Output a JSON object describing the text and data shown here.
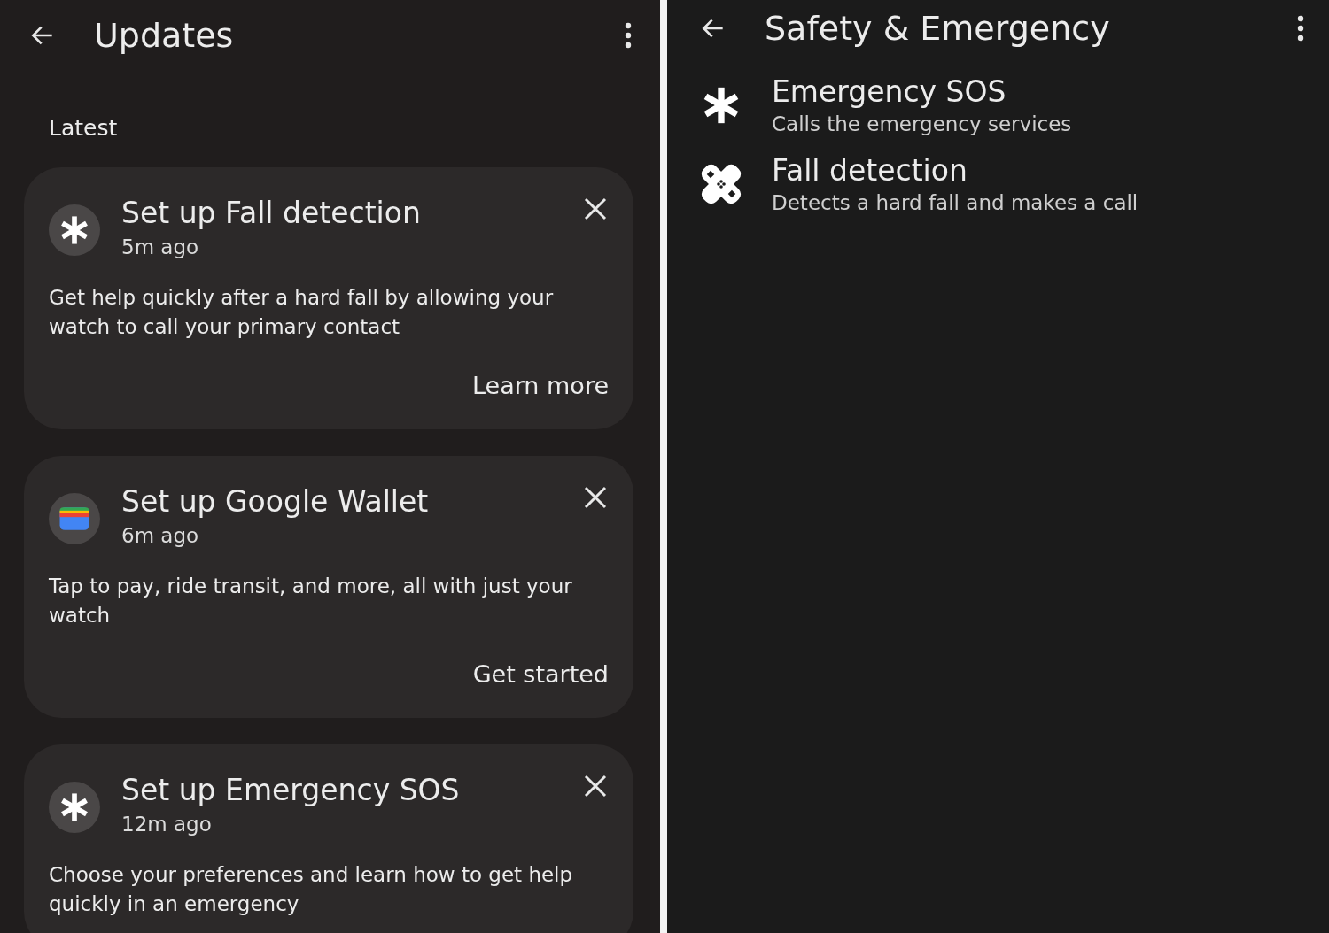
{
  "updates": {
    "title": "Updates",
    "section": "Latest",
    "cards": [
      {
        "kind": "asterisk",
        "title": "Set up Fall detection",
        "time": "5m ago",
        "body": "Get help quickly after a hard fall by allowing your watch to call your primary contact",
        "action": "Learn more"
      },
      {
        "kind": "wallet",
        "title": "Set up Google Wallet",
        "time": "6m ago",
        "body": "Tap to pay, ride transit, and more, all with just your watch",
        "action": "Get started"
      },
      {
        "kind": "asterisk",
        "title": "Set up Emergency SOS",
        "time": "12m ago",
        "body": "Choose your preferences and learn how to get help quickly in an emergency"
      }
    ]
  },
  "safety": {
    "title": "Safety & Emergency",
    "items": [
      {
        "kind": "asterisk",
        "title": "Emergency SOS",
        "subtitle": "Calls the emergency services"
      },
      {
        "kind": "bandage",
        "title": "Fall detection",
        "subtitle": "Detects a hard fall and makes a call"
      }
    ]
  }
}
